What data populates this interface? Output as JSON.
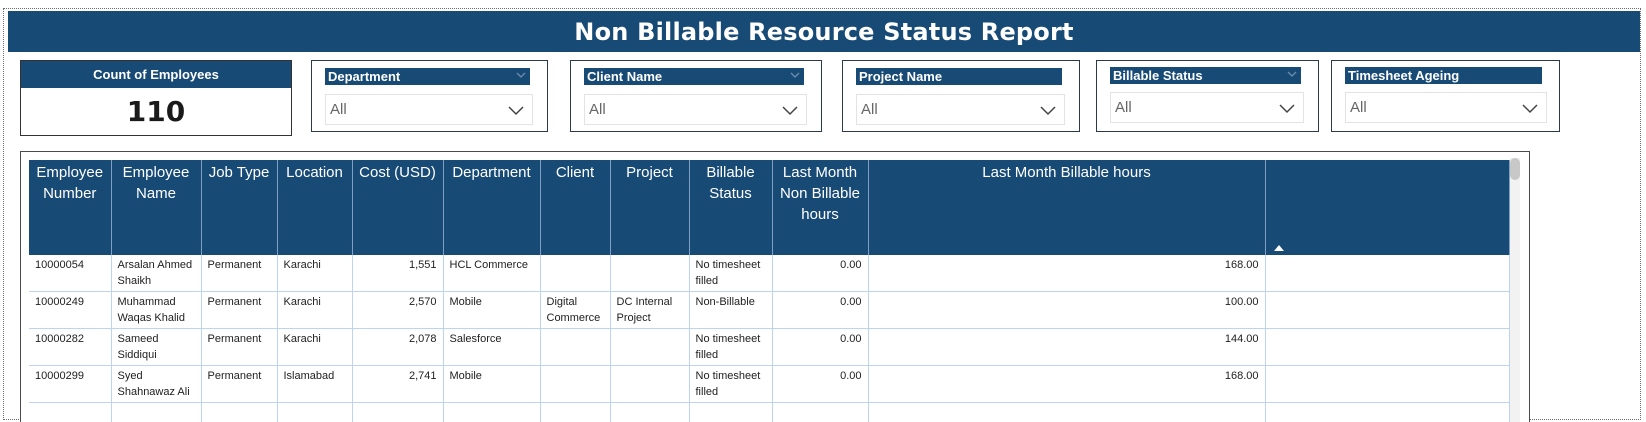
{
  "report": {
    "title": "Non Billable Resource Status Report"
  },
  "kpi": {
    "label": "Count of Employees",
    "value": "110"
  },
  "slicers": [
    {
      "label": "Department",
      "value": "All"
    },
    {
      "label": "Client Name",
      "value": "All"
    },
    {
      "label": "Project Name",
      "value": "All"
    },
    {
      "label": "Billable Status",
      "value": "All"
    },
    {
      "label": "Timesheet Ageing",
      "value": "All"
    }
  ],
  "table": {
    "columns": [
      "Employee Number",
      "Employee Name",
      "Job Type",
      "Location",
      "Cost (USD)",
      "Department",
      "Client",
      "Project",
      "Billable Status",
      "Last Month Non Billable hours",
      "Last Month Billable hours",
      ""
    ],
    "rows": [
      [
        "10000054",
        "Arsalan Ahmed Shaikh",
        "Permanent",
        "Karachi",
        "1,551",
        "HCL Commerce",
        "",
        "",
        "No timesheet filled",
        "0.00",
        "168.00",
        ""
      ],
      [
        "10000249",
        "Muhammad Waqas Khalid",
        "Permanent",
        "Karachi",
        "2,570",
        "Mobile",
        "Digital Commerce",
        "DC Internal Project",
        "Non-Billable",
        "0.00",
        "100.00",
        ""
      ],
      [
        "10000282",
        "Sameed Siddiqui",
        "Permanent",
        "Karachi",
        "2,078",
        "Salesforce",
        "",
        "",
        "No timesheet filled",
        "0.00",
        "144.00",
        ""
      ],
      [
        "10000299",
        "Syed Shahnawaz Ali",
        "Permanent",
        "Islamabad",
        "2,741",
        "Mobile",
        "",
        "",
        "No timesheet filled",
        "0.00",
        "168.00",
        ""
      ],
      [
        "",
        "",
        "",
        "",
        "",
        "",
        "",
        "",
        "",
        "",
        "",
        ""
      ]
    ]
  },
  "colors": {
    "header_blue": "#184a76",
    "grid_line": "#bcd3f2"
  },
  "icons": {
    "sort": "sort-ascending-icon",
    "dropdown": "chevron-down-icon"
  }
}
